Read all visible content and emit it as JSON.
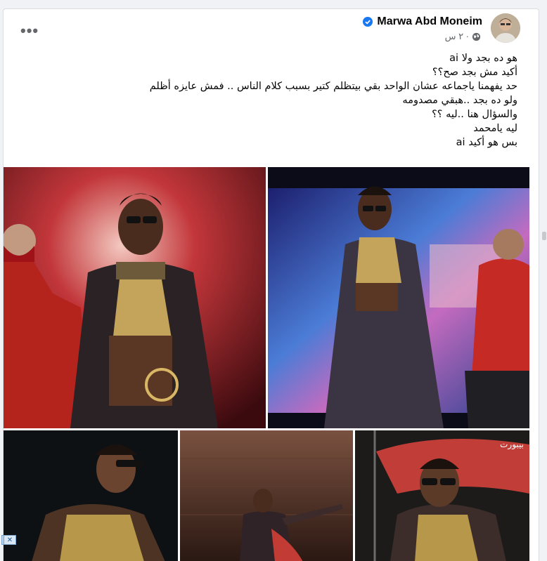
{
  "post": {
    "author": "Marwa Abd Moneim",
    "time": "٢ س ·",
    "more_label": "•••",
    "lines": [
      "هو ده بجد ولا    ai",
      "أكيد مش بجد صح؟؟",
      "حد يفهمنا ياجماعه عشان الواحد بقي بيتظلم كتير بسبب كلام الناس .. فمش عايزه أظلم",
      "ولو ده بجد ..هبقي مصدومه",
      "والسؤال هنا ..ليه ؟؟",
      "ليه يامحمد",
      "بس هو أكيد   ai"
    ]
  },
  "photos": {
    "watermark": "بيبورت"
  },
  "icons": {
    "verified": "verified-badge-icon",
    "globe": "globe-icon",
    "more": "more-options-icon",
    "close": "close-icon"
  },
  "colors": {
    "verified": "#1877f2",
    "text": "#050505",
    "secondary": "#65676b"
  },
  "close_label": "✕"
}
